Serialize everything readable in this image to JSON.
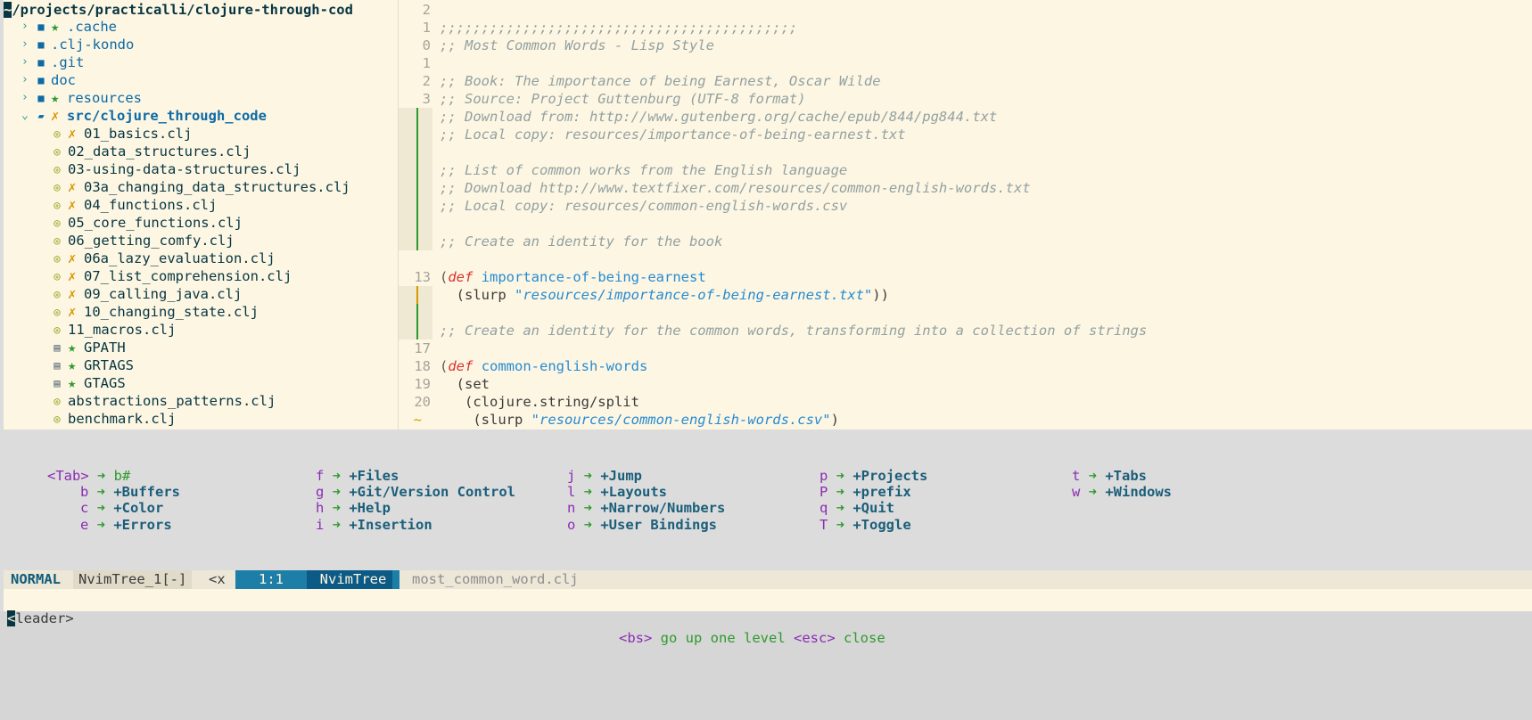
{
  "tree": {
    "path_cursor": "~",
    "path_rest": "/projects/practicalli/clojure-through-cod",
    "items": [
      {
        "name": ".cache",
        "kind": "dir",
        "git": "★"
      },
      {
        "name": ".clj-kondo",
        "kind": "dir",
        "git": ""
      },
      {
        "name": ".git",
        "kind": "dir",
        "git": ""
      },
      {
        "name": "doc",
        "kind": "dir",
        "git": ""
      },
      {
        "name": "resources",
        "kind": "dir",
        "git": "★"
      },
      {
        "name": "src/clojure_through_code",
        "kind": "dir-open",
        "git": "✗"
      },
      {
        "name": "01_basics.clj",
        "kind": "clj",
        "git": "✗"
      },
      {
        "name": "02_data_structures.clj",
        "kind": "clj",
        "git": ""
      },
      {
        "name": "03-using-data-structures.clj",
        "kind": "clj",
        "git": ""
      },
      {
        "name": "03a_changing_data_structures.clj",
        "kind": "clj",
        "git": "✗"
      },
      {
        "name": "04_functions.clj",
        "kind": "clj",
        "git": "✗"
      },
      {
        "name": "05_core_functions.clj",
        "kind": "clj",
        "git": ""
      },
      {
        "name": "06_getting_comfy.clj",
        "kind": "clj",
        "git": ""
      },
      {
        "name": "06a_lazy_evaluation.clj",
        "kind": "clj",
        "git": "✗"
      },
      {
        "name": "07_list_comprehension.clj",
        "kind": "clj",
        "git": "✗"
      },
      {
        "name": "09_calling_java.clj",
        "kind": "clj",
        "git": "✗"
      },
      {
        "name": "10_changing_state.clj",
        "kind": "clj",
        "git": "✗"
      },
      {
        "name": "11_macros.clj",
        "kind": "clj",
        "git": ""
      },
      {
        "name": "GPATH",
        "kind": "file",
        "git": "★"
      },
      {
        "name": "GRTAGS",
        "kind": "file",
        "git": "★"
      },
      {
        "name": "GTAGS",
        "kind": "file",
        "git": "★"
      },
      {
        "name": "abstractions_patterns.clj",
        "kind": "clj",
        "git": ""
      },
      {
        "name": "benchmark.clj",
        "kind": "clj",
        "git": ""
      }
    ]
  },
  "editor": {
    "lines": [
      {
        "num": "2",
        "sign": "",
        "segs": []
      },
      {
        "num": "1",
        "sign": "",
        "segs": [
          {
            "c": "cmt",
            "t": ";;;;;;;;;;;;;;;;;;;;;;;;;;;;;;;;;;;;;;;;;;;"
          }
        ]
      },
      {
        "num": "0",
        "sign": "",
        "segs": [
          {
            "c": "cmt",
            "t": ";; Most Common Words - Lisp Style"
          }
        ]
      },
      {
        "num": "1",
        "sign": "",
        "segs": []
      },
      {
        "num": "2",
        "sign": "",
        "segs": [
          {
            "c": "cmt",
            "t": ";; Book: The importance of being Earnest, Oscar Wilde"
          }
        ]
      },
      {
        "num": "3",
        "sign": "",
        "segs": [
          {
            "c": "cmt",
            "t": ";; Source: Project Guttenburg (UTF-8 format)"
          }
        ]
      },
      {
        "num": "",
        "sign": "add",
        "segs": [
          {
            "c": "cmt",
            "t": ";; Download from: http://www.gutenberg.org/cache/epub/844/pg844.txt"
          }
        ]
      },
      {
        "num": "",
        "sign": "add",
        "segs": [
          {
            "c": "cmt",
            "t": ";; Local copy: resources/importance-of-being-earnest.txt"
          }
        ]
      },
      {
        "num": "",
        "sign": "add",
        "segs": []
      },
      {
        "num": "",
        "sign": "add",
        "segs": [
          {
            "c": "cmt",
            "t": ";; List of common works from the English language"
          }
        ]
      },
      {
        "num": "",
        "sign": "add",
        "segs": [
          {
            "c": "cmt",
            "t": ";; Download http://www.textfixer.com/resources/common-english-words.txt"
          }
        ]
      },
      {
        "num": "",
        "sign": "add",
        "segs": [
          {
            "c": "cmt",
            "t": ";; Local copy: resources/common-english-words.csv"
          }
        ]
      },
      {
        "num": "",
        "sign": "add",
        "segs": []
      },
      {
        "num": "",
        "sign": "add",
        "segs": [
          {
            "c": "cmt",
            "t": ";; Create an identity for the book"
          }
        ]
      },
      {
        "num": "",
        "sign": "",
        "segs": []
      },
      {
        "num": "13",
        "sign": "",
        "segs": [
          {
            "c": "paren",
            "t": "("
          },
          {
            "c": "kw",
            "t": "def"
          },
          {
            "c": "",
            "t": " "
          },
          {
            "c": "fnname",
            "t": "importance-of-being-earnest"
          }
        ]
      },
      {
        "num": "",
        "sign": "change",
        "segs": [
          {
            "c": "",
            "t": "  (slurp "
          },
          {
            "c": "str",
            "t": "\"resources/importance-of-being-earnest.txt\""
          },
          {
            "c": "",
            "t": "))"
          }
        ]
      },
      {
        "num": "",
        "sign": "add",
        "segs": []
      },
      {
        "num": "",
        "sign": "add",
        "segs": [
          {
            "c": "cmt",
            "t": ";; Create an identity for the common words, transforming into a collection of strings"
          }
        ]
      },
      {
        "num": "17",
        "sign": "",
        "segs": []
      },
      {
        "num": "18",
        "sign": "",
        "segs": [
          {
            "c": "paren",
            "t": "("
          },
          {
            "c": "kw",
            "t": "def"
          },
          {
            "c": "",
            "t": " "
          },
          {
            "c": "fnname",
            "t": "common-english-words"
          }
        ]
      },
      {
        "num": "19",
        "sign": "",
        "segs": [
          {
            "c": "",
            "t": "  (set"
          }
        ]
      },
      {
        "num": "20",
        "sign": "",
        "segs": [
          {
            "c": "",
            "t": "   (clojure.string/split"
          }
        ]
      },
      {
        "num": "~",
        "sign": "",
        "segs": [
          {
            "c": "",
            "t": "    (slurp "
          },
          {
            "c": "str",
            "t": "\"resources/common-english-words.csv\""
          },
          {
            "c": "",
            "t": ")"
          }
        ]
      }
    ]
  },
  "whichkey": {
    "columns": [
      [
        {
          "k": "<Tab>",
          "d": "b#",
          "bold": false
        },
        {
          "k": "b",
          "d": "+Buffers",
          "bold": true
        },
        {
          "k": "c",
          "d": "+Color",
          "bold": true
        },
        {
          "k": "e",
          "d": "+Errors",
          "bold": true
        }
      ],
      [
        {
          "k": "f",
          "d": "+Files",
          "bold": true
        },
        {
          "k": "g",
          "d": "+Git/Version Control",
          "bold": true
        },
        {
          "k": "h",
          "d": "+Help",
          "bold": true
        },
        {
          "k": "i",
          "d": "+Insertion",
          "bold": true
        }
      ],
      [
        {
          "k": "j",
          "d": "+Jump",
          "bold": true
        },
        {
          "k": "l",
          "d": "+Layouts",
          "bold": true
        },
        {
          "k": "n",
          "d": "+Narrow/Numbers",
          "bold": true
        },
        {
          "k": "o",
          "d": "+User Bindings",
          "bold": true
        }
      ],
      [
        {
          "k": "p",
          "d": "+Projects",
          "bold": true
        },
        {
          "k": "P",
          "d": "+prefix",
          "bold": true
        },
        {
          "k": "q",
          "d": "+Quit",
          "bold": true
        },
        {
          "k": "T",
          "d": "+Toggle",
          "bold": true
        }
      ],
      [
        {
          "k": "t",
          "d": "+Tabs",
          "bold": true
        },
        {
          "k": "w",
          "d": "+Windows",
          "bold": true
        }
      ]
    ],
    "arrow": "➜"
  },
  "status": {
    "mode": "NORMAL",
    "buffer": "NvimTree_1[-]",
    "close": "<x",
    "position": "1:1",
    "filetype": "NvimTree",
    "other_buffer": "most_common_word.clj"
  },
  "cmdline": {
    "leader_cursor": "<",
    "leader_rest": "leader>",
    "hint_key1": "<bs>",
    "hint_text1": "go up one level",
    "hint_key2": "<esc>",
    "hint_text2": "close"
  },
  "colors": {
    "background": "#fdf6e3",
    "accent_blue": "#268bd2",
    "keyword_red": "#dc322f",
    "git_added": "#2f9a2f",
    "git_changed": "#d79700"
  }
}
